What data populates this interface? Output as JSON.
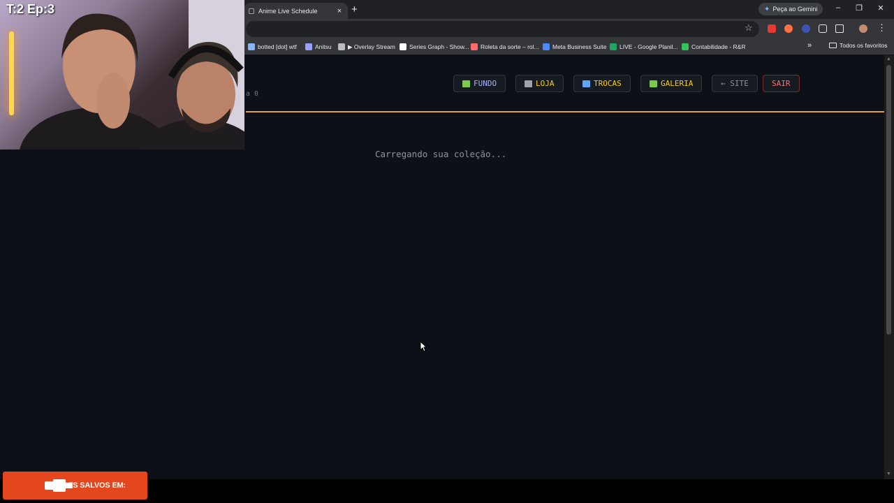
{
  "browser": {
    "tab_title": "Anime Live Schedule",
    "new_tab": "+",
    "gemini_label": "Peça ao Gemini",
    "bookmarks": [
      {
        "label": "botted [dot] wtf",
        "color": "#8ab4f8"
      },
      {
        "label": "Anitsu",
        "color": "#9aa0ff"
      },
      {
        "label": "▶ Overlay Stream",
        "color": "#bdbdbd"
      },
      {
        "label": "Series Graph - Show...",
        "color": "#ffffff"
      },
      {
        "label": "Roleta da sorte – rol...",
        "color": "#ff6a6a"
      },
      {
        "label": "Meta Business Suite",
        "color": "#4a8cff"
      },
      {
        "label": "LIVE - Google Planil...",
        "color": "#1fa463"
      },
      {
        "label": "Contabilidade - R&R",
        "color": "#35c25a"
      }
    ],
    "all_bookmarks": "Todos os favoritos"
  },
  "page": {
    "counter": "a 0",
    "nav": [
      {
        "label": "FUNDO",
        "color": "#a5b4fc",
        "icon": "image-icon",
        "icon_color": "#7ec850"
      },
      {
        "label": "LOJA",
        "color": "#facc15",
        "icon": "cart-icon",
        "icon_color": "#9ca3af"
      },
      {
        "label": "TROCAS",
        "color": "#facc15",
        "icon": "swap-icon",
        "icon_color": "#60a5fa"
      },
      {
        "label": "GALERIA",
        "color": "#facc15",
        "icon": "gallery-icon",
        "icon_color": "#7ec850"
      },
      {
        "label": "← SITE",
        "color": "#8b949e",
        "icon": "",
        "icon_color": ""
      },
      {
        "label": "SAIR",
        "color": "#f87171",
        "icon": "",
        "icon_color": ""
      }
    ],
    "accent_color": "#e3a03c",
    "loading_text": "Carregando sua coleção..."
  },
  "overlay": {
    "episode_label": "T:2 Ep:3",
    "salvos_text": "CTS SALVOS EM:"
  }
}
